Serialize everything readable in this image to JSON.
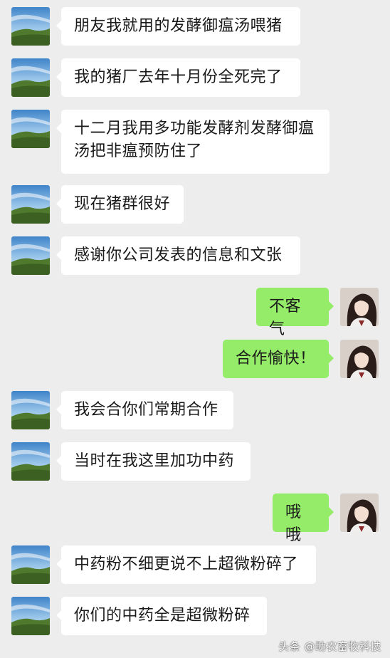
{
  "chat": {
    "messages": [
      {
        "side": "left",
        "text": "朋友我就用的发酵御瘟汤喂猪"
      },
      {
        "side": "left",
        "text": "我的猪厂去年十月份全死完了"
      },
      {
        "side": "left",
        "text": "十二月我用多功能发酵剂发酵御瘟\n汤把非瘟预防住了"
      },
      {
        "side": "left",
        "text": "现在猪群很好"
      },
      {
        "side": "left",
        "text": "感谢你公司发表的信息和文张"
      },
      {
        "side": "right",
        "text": "不客气"
      },
      {
        "side": "right",
        "text": "合作愉快！"
      },
      {
        "side": "left",
        "text": "我会合你们常期合作"
      },
      {
        "side": "left",
        "text": "当时在我这里加功中药"
      },
      {
        "side": "right",
        "text": "哦哦"
      },
      {
        "side": "left",
        "text": "中药粉不细更说不上超微粉碎了"
      },
      {
        "side": "left",
        "text": "你们的中药全是超微粉碎"
      }
    ]
  },
  "watermark": "头条 @助农畜牧科技",
  "colors": {
    "background": "#ededed",
    "incoming_bubble": "#ffffff",
    "outgoing_bubble": "#95ec69",
    "text": "#1a1a1a"
  },
  "icons": {
    "incoming_avatar": "landscape-avatar-icon",
    "outgoing_avatar": "portrait-avatar-icon"
  }
}
